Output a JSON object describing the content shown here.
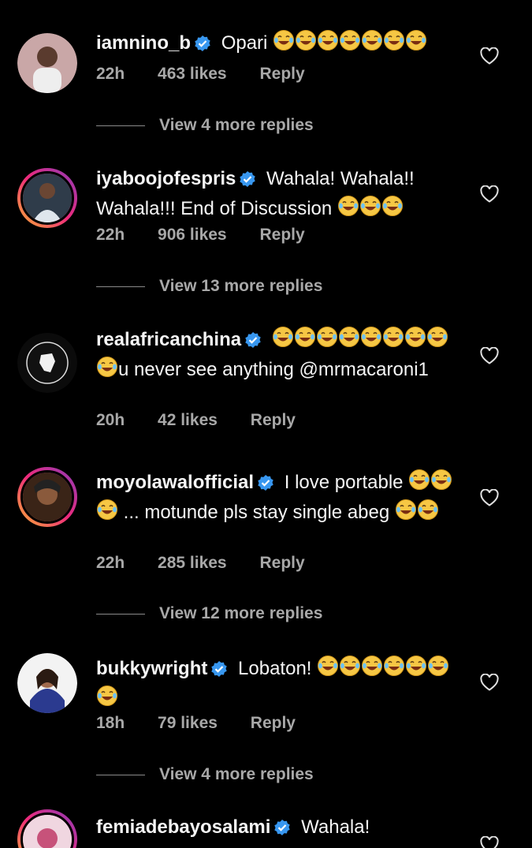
{
  "comments": [
    {
      "username": "iamnino_b",
      "text": "Opari",
      "emoji_count": 7,
      "text_after": "",
      "time": "22h",
      "likes": "463 likes",
      "reply": "Reply",
      "view_replies": "View 4 more replies"
    },
    {
      "username": "iyaboojofespris",
      "text": "Wahala! Wahala!! Wahala!!! End of Discussion",
      "emoji_count": 3,
      "text_after": "",
      "time": "22h",
      "likes": "906 likes",
      "reply": "Reply",
      "view_replies": "View 13 more replies"
    },
    {
      "username": "realafricanchina",
      "text": "",
      "emoji_count": 9,
      "text_after": "u never see anything @mrmacaroni1",
      "time": "20h",
      "likes": "42 likes",
      "reply": "Reply",
      "view_replies": ""
    },
    {
      "username": "moyolawalofficial",
      "text": "I love portable",
      "emoji_count": 3,
      "text_after": "... motunde pls stay single abeg",
      "emoji_after_count": 2,
      "time": "22h",
      "likes": "285 likes",
      "reply": "Reply",
      "view_replies": "View 12 more replies"
    },
    {
      "username": "bukkywright",
      "text": "Lobaton!",
      "emoji_count": 7,
      "text_after": "",
      "time": "18h",
      "likes": "79 likes",
      "reply": "Reply",
      "view_replies": "View 4 more replies"
    },
    {
      "username": "femiadebayosalami",
      "text": "Wahala!",
      "emoji_count": 0,
      "text_after": "",
      "time": "",
      "likes": "",
      "reply": "",
      "view_replies": ""
    }
  ],
  "colors": {
    "background": "#000000",
    "text": "#f5f5f5",
    "muted": "#a8a8a8",
    "verified": "#3897f0",
    "emoji": "#f6c744"
  },
  "icons": {
    "verified": "verified-badge-icon",
    "like": "heart-icon",
    "emoji": "face-with-tears-of-joy-icon"
  }
}
